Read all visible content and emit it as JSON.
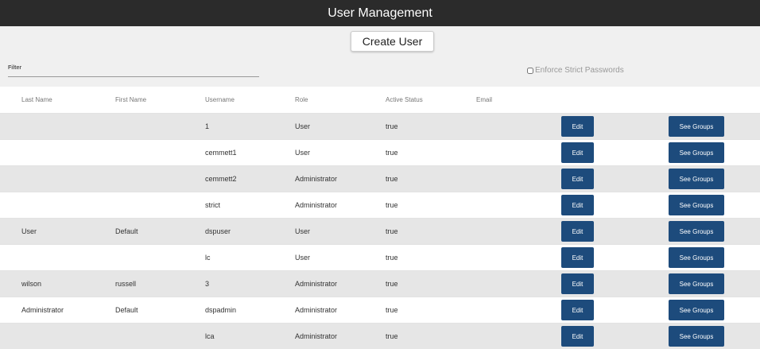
{
  "app": {
    "title": "User Management"
  },
  "toolbar": {
    "create_label": "Create User"
  },
  "filter": {
    "label": "Filter",
    "value": "",
    "placeholder": ""
  },
  "strict_passwords": {
    "label": "Enforce Strict Passwords",
    "checked": false
  },
  "table": {
    "headers": [
      "Last Name",
      "First Name",
      "Username",
      "Role",
      "Active Status",
      "Email"
    ],
    "edit_label": "Edit",
    "groups_label": "See Groups",
    "rows": [
      {
        "last_name": "",
        "first_name": "",
        "username": "1",
        "role": "User",
        "active": "true",
        "email": ""
      },
      {
        "last_name": "",
        "first_name": "",
        "username": "cemmett1",
        "role": "User",
        "active": "true",
        "email": ""
      },
      {
        "last_name": "",
        "first_name": "",
        "username": "cemmett2",
        "role": "Administrator",
        "active": "true",
        "email": ""
      },
      {
        "last_name": "",
        "first_name": "",
        "username": "strict",
        "role": "Administrator",
        "active": "true",
        "email": ""
      },
      {
        "last_name": "User",
        "first_name": "Default",
        "username": "dspuser",
        "role": "User",
        "active": "true",
        "email": ""
      },
      {
        "last_name": "",
        "first_name": "",
        "username": "lc",
        "role": "User",
        "active": "true",
        "email": ""
      },
      {
        "last_name": "wilson",
        "first_name": "russell",
        "username": "3",
        "role": "Administrator",
        "active": "true",
        "email": ""
      },
      {
        "last_name": "Administrator",
        "first_name": "Default",
        "username": "dspadmin",
        "role": "Administrator",
        "active": "true",
        "email": ""
      },
      {
        "last_name": "",
        "first_name": "",
        "username": "lca",
        "role": "Administrator",
        "active": "true",
        "email": ""
      }
    ]
  },
  "colors": {
    "title_bar": "#2b2b2b",
    "button": "#1d4b7c",
    "row_shade": "#e6e6e6",
    "background": "#f0f0f0"
  }
}
